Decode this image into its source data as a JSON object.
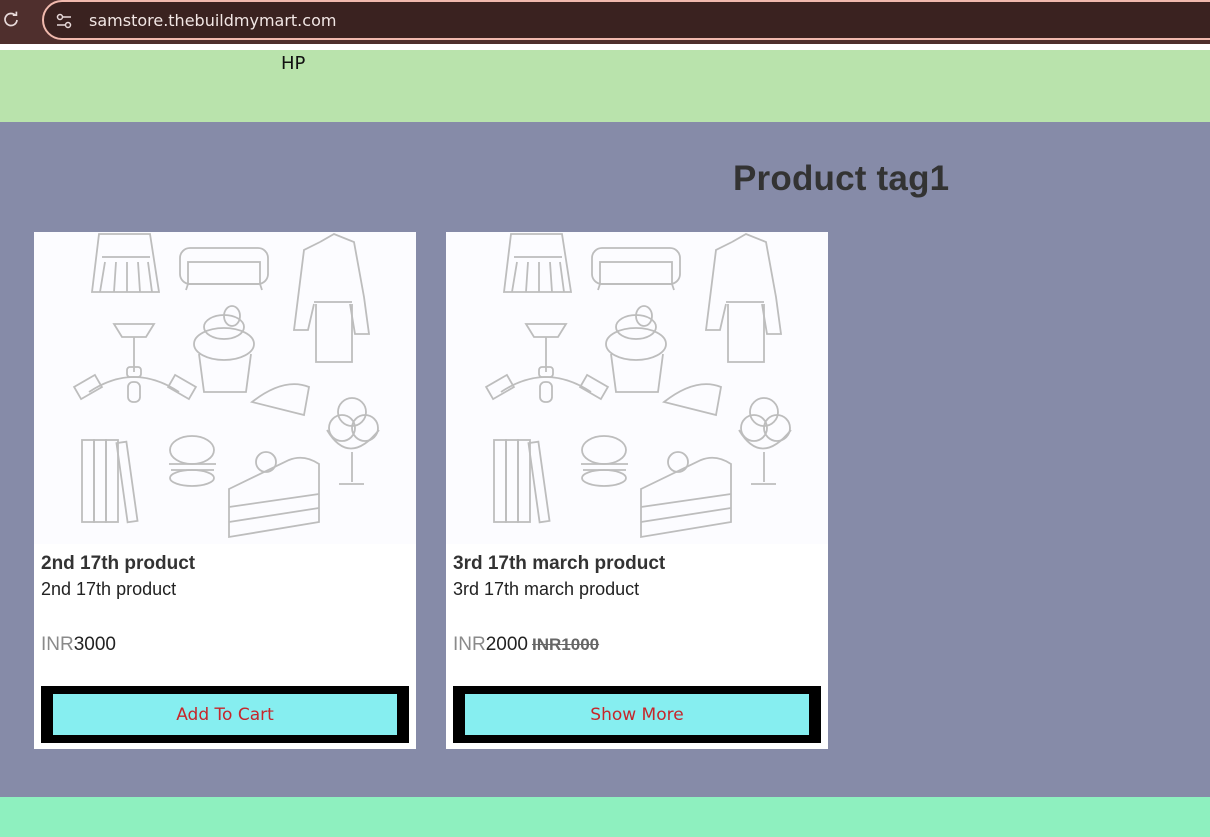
{
  "browser": {
    "url": "samstore.thebuildmymart.com"
  },
  "header": {
    "brand": "HP"
  },
  "section": {
    "title": "Product tag1"
  },
  "products": [
    {
      "title": "2nd 17th product",
      "description": "2nd 17th product",
      "currency": "INR",
      "price": "3000",
      "old_price": "",
      "button_label": "Add To Cart"
    },
    {
      "title": "3rd 17th march product",
      "description": "3rd 17th march product",
      "currency": "INR",
      "price": "2000",
      "old_price": "INR1000",
      "button_label": "Show More"
    }
  ],
  "colors": {
    "browser_bar": "#4f2f2d",
    "header_band": "#b9e3ac",
    "main_background": "#868ba8",
    "button_fill": "#86eef0",
    "button_text": "#c6262b",
    "footer_band": "#8ef0bf"
  },
  "icons": {
    "reload": "reload-icon",
    "site_settings": "site-settings-icon"
  }
}
